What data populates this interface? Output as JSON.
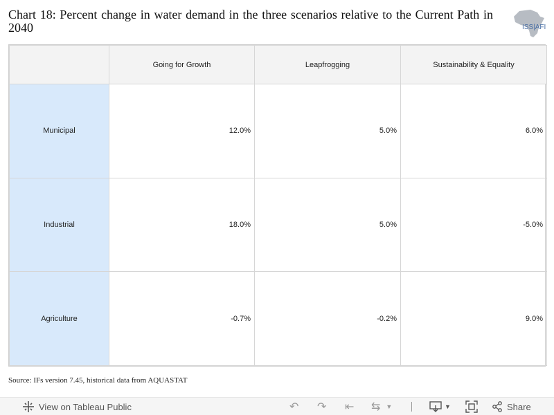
{
  "title": "Chart 18: Percent change in water demand in the three scenarios relative to the Current Path in 2040",
  "logo": {
    "text": "ISS|AFI"
  },
  "chart_data": {
    "type": "table",
    "columns": [
      "Going for Growth",
      "Leapfrogging",
      "Sustainability & Equality"
    ],
    "rows": [
      {
        "label": "Municipal",
        "values": [
          "12.0%",
          "5.0%",
          "6.0%"
        ]
      },
      {
        "label": "Industrial",
        "values": [
          "18.0%",
          "5.0%",
          "-5.0%"
        ]
      },
      {
        "label": "Agriculture",
        "values": [
          "-0.7%",
          "-0.2%",
          "9.0%"
        ]
      }
    ],
    "row_header_color": "#d8e9fb",
    "col_header_color": "#f3f3f3"
  },
  "source": "Source: IFs version 7.45, historical data from AQUASTAT",
  "toolbar": {
    "view_label": "View on Tableau Public",
    "share_label": "Share",
    "icons": [
      "tableau-icon",
      "undo-icon",
      "redo-icon",
      "revert-icon",
      "refresh-icon",
      "download-icon",
      "fullscreen-icon",
      "share-icon"
    ]
  }
}
